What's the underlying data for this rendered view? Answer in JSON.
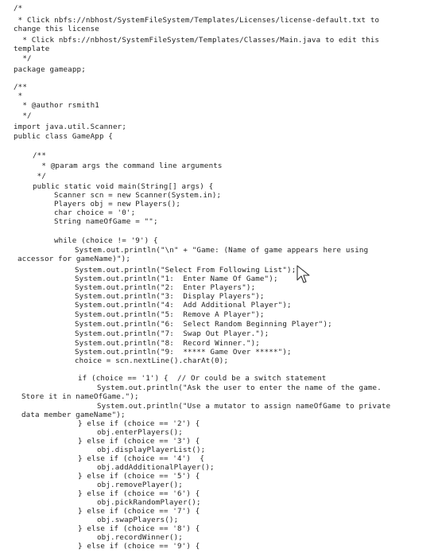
{
  "code": {
    "lines": [
      "/*",
      " * Click nbfs://nbhost/SystemFileSystem/Templates/Licenses/license-default.txt to",
      "change this license",
      "  * Click nbfs://nbhost/SystemFileSystem/Templates/Classes/Main.java to edit this",
      "template",
      "  */",
      "package gameapp;",
      "/**",
      " *",
      "  * @author rsmith1",
      "  */",
      "import java.util.Scanner;",
      "public class GameApp {",
      "/**",
      "  * @param args the command line arguments",
      " */",
      "public static void main(String[] args) {",
      "Scanner scn = new Scanner(System.in);",
      "Players obj = new Players();",
      "char choice = '0';",
      "String nameOfGame = \"\";",
      "while (choice != '9') {",
      "System.out.println(\"\\n\" + \"Game: (Name of game appears here using",
      "accessor for gameName)\");",
      "System.out.println(\"Select From Following List\");",
      "System.out.println(\"1:  Enter Name Of Game\");",
      "System.out.println(\"2:  Enter Players\");",
      "System.out.println(\"3:  Display Players\");",
      "System.out.println(\"4:  Add Additional Player\");",
      "System.out.println(\"5:  Remove A Player\");",
      "System.out.println(\"6:  Select Random Beginning Player\");",
      "System.out.println(\"7:  Swap Out Player.\");",
      "System.out.println(\"8:  Record Winner.\");",
      "System.out.println(\"9:  ***** Game Over *****\");",
      "choice = scn.nextLine().charAt(0);",
      "if (choice == '1') {  // Or could be a switch statement",
      "System.out.println(\"Ask the user to enter the name of the game.",
      "Store it in nameOfGame.\");",
      "System.out.println(\"Use a mutator to assign nameOfGame to private",
      "data member gameName\");",
      "} else if (choice == '2') {",
      "obj.enterPlayers();",
      "} else if (choice == '3') {",
      "obj.displayPlayerList();",
      "} else if (choice == '4')  {",
      "obj.addAdditionalPlayer();",
      "} else if (choice == '5') {",
      "obj.removePlayer();",
      "} else if (choice == '6') {",
      "obj.pickRandomPlayer();",
      "} else if (choice == '7') {",
      "obj.swapPlayers();",
      "} else if (choice == '8') {",
      "obj.recordWinner();",
      "} else if (choice == '9') {"
    ]
  }
}
